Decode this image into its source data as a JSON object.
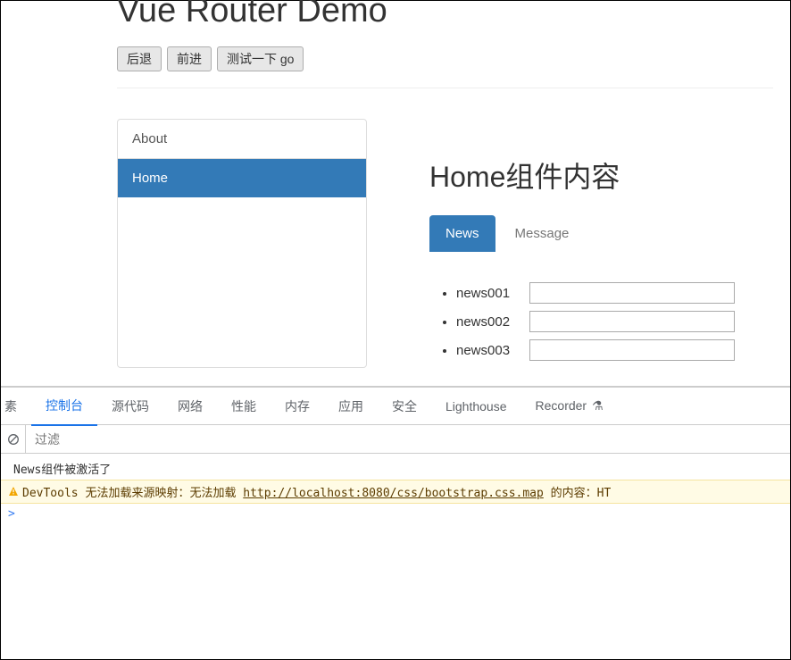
{
  "page": {
    "title": "Vue Router Demo"
  },
  "buttons": {
    "back": "后退",
    "forward": "前进",
    "test_go": "测试一下 go"
  },
  "sidebar": {
    "items": [
      {
        "label": "About",
        "active": false
      },
      {
        "label": "Home",
        "active": true
      }
    ]
  },
  "main": {
    "title": "Home组件内容",
    "tabs": [
      {
        "label": "News",
        "active": true
      },
      {
        "label": "Message",
        "active": false
      }
    ],
    "news": [
      {
        "label": "news001",
        "value": ""
      },
      {
        "label": "news002",
        "value": ""
      },
      {
        "label": "news003",
        "value": ""
      }
    ]
  },
  "devtools": {
    "tabs": {
      "elements_partial": "素",
      "console": "控制台",
      "sources": "源代码",
      "network": "网络",
      "performance": "性能",
      "memory": "内存",
      "application": "应用",
      "security": "安全",
      "lighthouse": "Lighthouse",
      "recorder": "Recorder"
    },
    "filter_placeholder": "过滤",
    "console_log": "News组件被激活了",
    "warning": {
      "prefix": "DevTools",
      "text1": " 无法加载来源映射：无法加载 ",
      "url": "http://localhost:8080/css/bootstrap.css.map",
      "text2": " 的内容：HT"
    },
    "prompt": ">"
  }
}
